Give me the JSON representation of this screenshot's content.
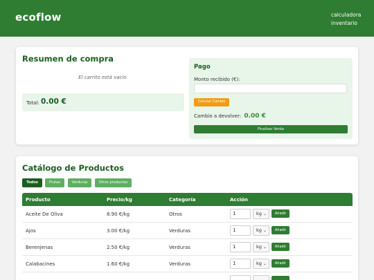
{
  "header": {
    "brand": "ecoflow",
    "nav": [
      "calculadora",
      "inventario"
    ]
  },
  "summary": {
    "title": "Resumen de compra",
    "empty_message": "El carrito está vacío",
    "total_label": "Total:",
    "total_value": "0.00 €"
  },
  "payment": {
    "title": "Pago",
    "amount_label": "Monto recibido (€):",
    "amount_value": "",
    "calc_button": "Calcular Cambio",
    "change_label": "Cambio a devolver:",
    "change_value": "0.00 €",
    "finish_button": "Finalizar Venta"
  },
  "catalog": {
    "title": "Catálogo de Productos",
    "filters": [
      "Todos",
      "Frutas",
      "Verduras",
      "Otros productos"
    ],
    "active_filter": "Todos",
    "columns": [
      "Producto",
      "Precio/kg",
      "Categoría",
      "Acción"
    ],
    "rows": [
      {
        "product": "Aceite De Oliva",
        "price": "8.90 €/kg",
        "category": "Otros",
        "qty": "1",
        "unit": "kg",
        "action": "Añadir"
      },
      {
        "product": "Ajos",
        "price": "3.00 €/kg",
        "category": "Verduras",
        "qty": "1",
        "unit": "kg",
        "action": "Añadir"
      },
      {
        "product": "Berenjenas",
        "price": "2.50 €/kg",
        "category": "Verduras",
        "qty": "1",
        "unit": "kg",
        "action": "Añadir"
      },
      {
        "product": "Calabacines",
        "price": "1.60 €/kg",
        "category": "Verduras",
        "qty": "1",
        "unit": "kg",
        "action": "Añadir"
      },
      {
        "product": "",
        "price": "",
        "category": "",
        "qty": "",
        "unit": "",
        "action": ""
      }
    ]
  },
  "colors": {
    "primary": "#2e7d32",
    "dark_green": "#1b5e20",
    "light_green_bg": "#e8f5e9",
    "orange": "#f39c12",
    "filter_inactive": "#5fae62"
  },
  "icons": {
    "select_chevron": "chevron-down-icon"
  }
}
